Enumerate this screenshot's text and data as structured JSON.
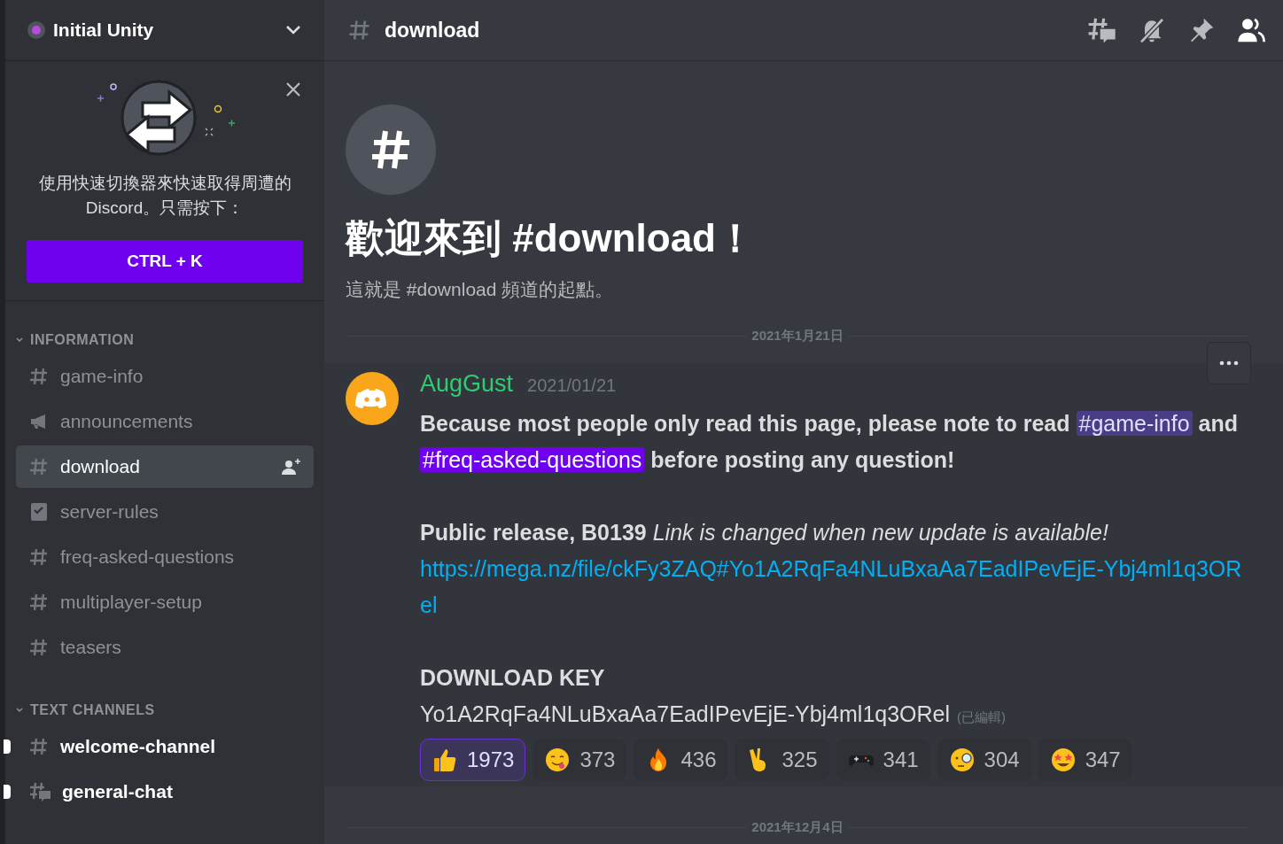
{
  "server": {
    "name": "Initial Unity"
  },
  "switcher_tip": {
    "text": "使用快速切換器來快速取得周遭的 Discord。只需按下：",
    "button": "CTRL + K"
  },
  "categories": [
    {
      "name": "INFORMATION",
      "expanded": true,
      "channels": [
        {
          "name": "game-info",
          "kind": "text",
          "selected": false,
          "unread": false
        },
        {
          "name": "announcements",
          "kind": "announcement",
          "selected": false,
          "unread": false
        },
        {
          "name": "download",
          "kind": "text",
          "selected": true,
          "unread": false
        },
        {
          "name": "server-rules",
          "kind": "rules",
          "selected": false,
          "unread": false
        },
        {
          "name": "freq-asked-questions",
          "kind": "text",
          "selected": false,
          "unread": false
        },
        {
          "name": "multiplayer-setup",
          "kind": "text",
          "selected": false,
          "unread": false
        },
        {
          "name": "teasers",
          "kind": "text",
          "selected": false,
          "unread": false
        }
      ]
    },
    {
      "name": "TEXT CHANNELS",
      "expanded": true,
      "channels": [
        {
          "name": "welcome-channel",
          "kind": "text",
          "selected": false,
          "unread": true
        },
        {
          "name": "general-chat",
          "kind": "thread",
          "selected": false,
          "unread": true
        }
      ]
    }
  ],
  "channel_header": {
    "name": "download"
  },
  "welcome": {
    "title": "歡迎來到 #download！",
    "subtitle": "這就是 #download 頻道的起點。"
  },
  "dividers": [
    "2021年1月21日",
    "2021年12月4日"
  ],
  "message": {
    "author": "AugGust",
    "timestamp": "2021/01/21",
    "intro": [
      {
        "kind": "text",
        "text": "Because most people only read this page, please note to read "
      },
      {
        "kind": "mention",
        "symbol": "#",
        "text": "game-info",
        "selected": false
      },
      {
        "kind": "text",
        "text": " and "
      },
      {
        "kind": "mention",
        "symbol": "#",
        "text": "freq-asked-questions",
        "selected": true
      },
      {
        "kind": "text",
        "text": " before posting any question!"
      }
    ],
    "release": "**Public release, B0139** *Link is changed when new update is available!*",
    "link": "https://mega.nz/file/ckFy3ZAQ#Yo1A2RqFa4NLuBxaAa7EadIPevEjE-Ybj4ml1q3ORel",
    "key_heading": "DOWNLOAD KEY",
    "key": "Yo1A2RqFa4NLuBxaAa7EadIPevEjE-Ybj4ml1q3ORel",
    "edited": "(已編輯)",
    "reactions": [
      {
        "kind": "thumbs-up",
        "count": "1973",
        "selected": true
      },
      {
        "kind": "yum",
        "count": "373",
        "selected": false
      },
      {
        "kind": "fire",
        "count": "436",
        "selected": false
      },
      {
        "kind": "victory",
        "count": "325",
        "selected": false
      },
      {
        "kind": "gamepad",
        "count": "341",
        "selected": false
      },
      {
        "kind": "monocle",
        "count": "304",
        "selected": false
      },
      {
        "kind": "star-struck",
        "count": "347",
        "selected": false
      }
    ]
  }
}
